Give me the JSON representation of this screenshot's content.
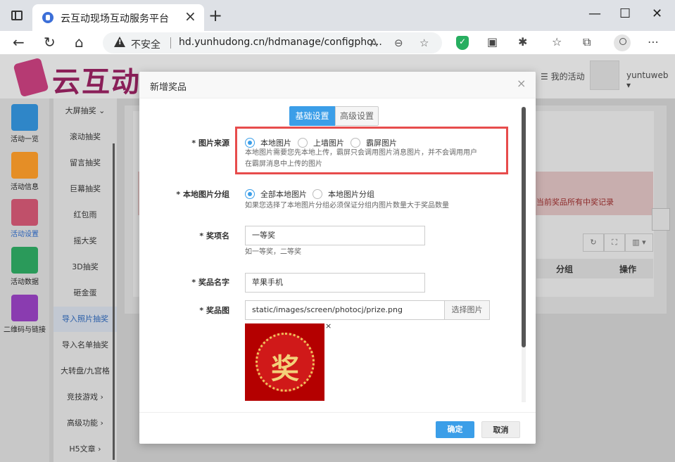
{
  "browser": {
    "tab_title": "云互动现场互动服务平台",
    "address_insecure": "不安全",
    "url": "hd.yunhudong.cn/hdmanage/configpho..."
  },
  "header": {
    "logo_text": "云互动",
    "my_activity": "☰ 我的活动",
    "username": "yuntuweb ▾"
  },
  "rail": [
    {
      "label": "活动一览",
      "color": "#2f86c8"
    },
    {
      "label": "活动信息",
      "color": "#e58e26"
    },
    {
      "label": "活动设置",
      "color": "#c0506a"
    },
    {
      "label": "活动数据",
      "color": "#2a9a5a"
    },
    {
      "label": "二维码与链接",
      "color": "#8a3cb0"
    }
  ],
  "menu": [
    "大屏抽奖 ⌄",
    "滚动抽奖",
    "留言抽奖",
    "巨幕抽奖",
    "红包雨",
    "摇大奖",
    "3D抽奖",
    "砸金蛋",
    "导入照片抽奖",
    "导入名单抽奖",
    "大转盘/九宫格",
    "竞技游戏 ›",
    "高级功能 ›",
    "H5文章 ›"
  ],
  "content": {
    "alert_text": "当前奖品所有中奖记录",
    "col_group": "分组",
    "col_action": "操作",
    "tool_refresh": "↻",
    "tool_expand": "⛶",
    "tool_columns": "▥ ▾"
  },
  "modal": {
    "title": "新增奖品",
    "tabs": {
      "basic": "基础设置",
      "advanced": "高级设置"
    },
    "image_source": {
      "label": "* 图片来源",
      "options": [
        "本地图片",
        "上墙图片",
        "霸屏图片"
      ],
      "help_line1": "本地图片需要您先本地上传，霸屏只会调用图片消息图片，并不会调用用户",
      "help_line2": "在霸屏消息中上传的图片"
    },
    "image_group": {
      "label": "* 本地图片分组",
      "options": [
        "全部本地图片",
        "本地图片分组"
      ],
      "help": "如果您选择了本地图片分组必须保证分组内图片数量大于奖品数量"
    },
    "prize_tier": {
      "label": "* 奖项名",
      "value": "一等奖",
      "help": "如一等奖，二等奖"
    },
    "prize_name": {
      "label": "* 奖品名字",
      "value": "苹果手机"
    },
    "prize_image": {
      "label": "* 奖品图",
      "value": "static/images/screen/photocj/prize.png",
      "pick": "选择图片",
      "preview_char": "奖",
      "remove": "×"
    },
    "ok": "确定",
    "cancel": "取消",
    "close": "×"
  }
}
